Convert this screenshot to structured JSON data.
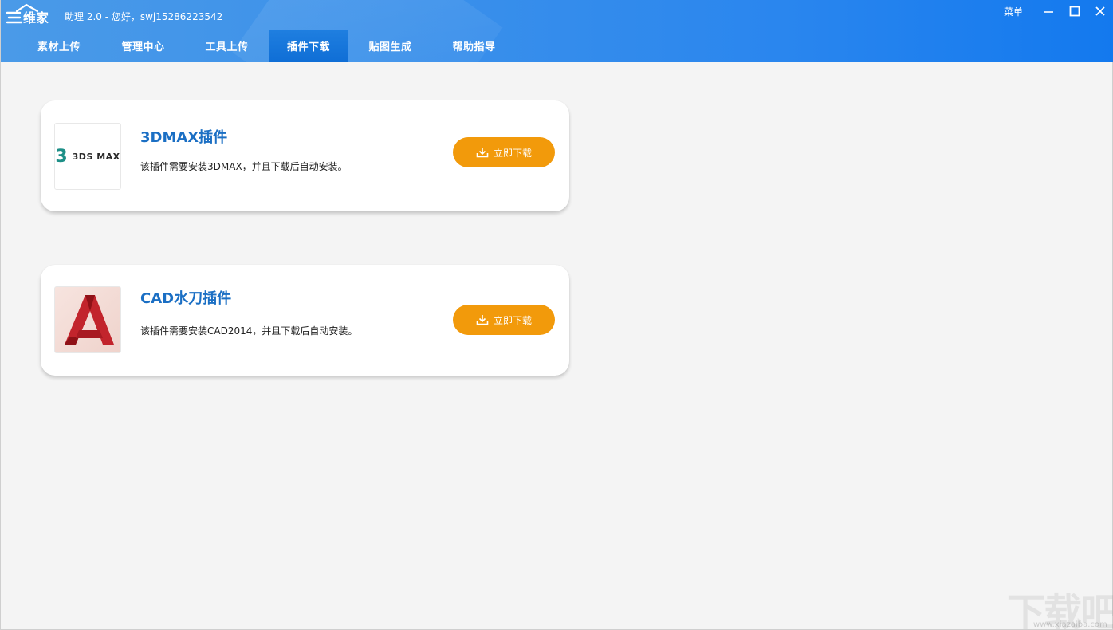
{
  "window": {
    "title": "助理 2.0 - 您好，swj15286223542",
    "menu_label": "菜单",
    "logo_text": "三维家"
  },
  "tabs": [
    {
      "label": "素材上传",
      "active": false
    },
    {
      "label": "管理中心",
      "active": false
    },
    {
      "label": "工具上传",
      "active": false
    },
    {
      "label": "插件下载",
      "active": true
    },
    {
      "label": "贴图生成",
      "active": false
    },
    {
      "label": "帮助指导",
      "active": false
    }
  ],
  "plugins": [
    {
      "name": "3DMAX插件",
      "description": "该插件需要安装3DMAX，并且下载后自动安装。",
      "button_label": "立即下载",
      "icon": "3ds-max-logo",
      "logo_number": "3",
      "logo_text": "3DS MAX"
    },
    {
      "name": "CAD水刀插件",
      "description": "该插件需要安装CAD2014，并且下载后自动安装。",
      "button_label": "立即下载",
      "icon": "autocad-logo"
    }
  ],
  "colors": {
    "header_blue": "#2a86ee",
    "tab_active": "#0f6ed6",
    "title_blue": "#1b6fc4",
    "button_orange": "#f29a0b"
  },
  "watermark": {
    "text": "下载吧",
    "sub": "www.xiazaiba.com"
  }
}
